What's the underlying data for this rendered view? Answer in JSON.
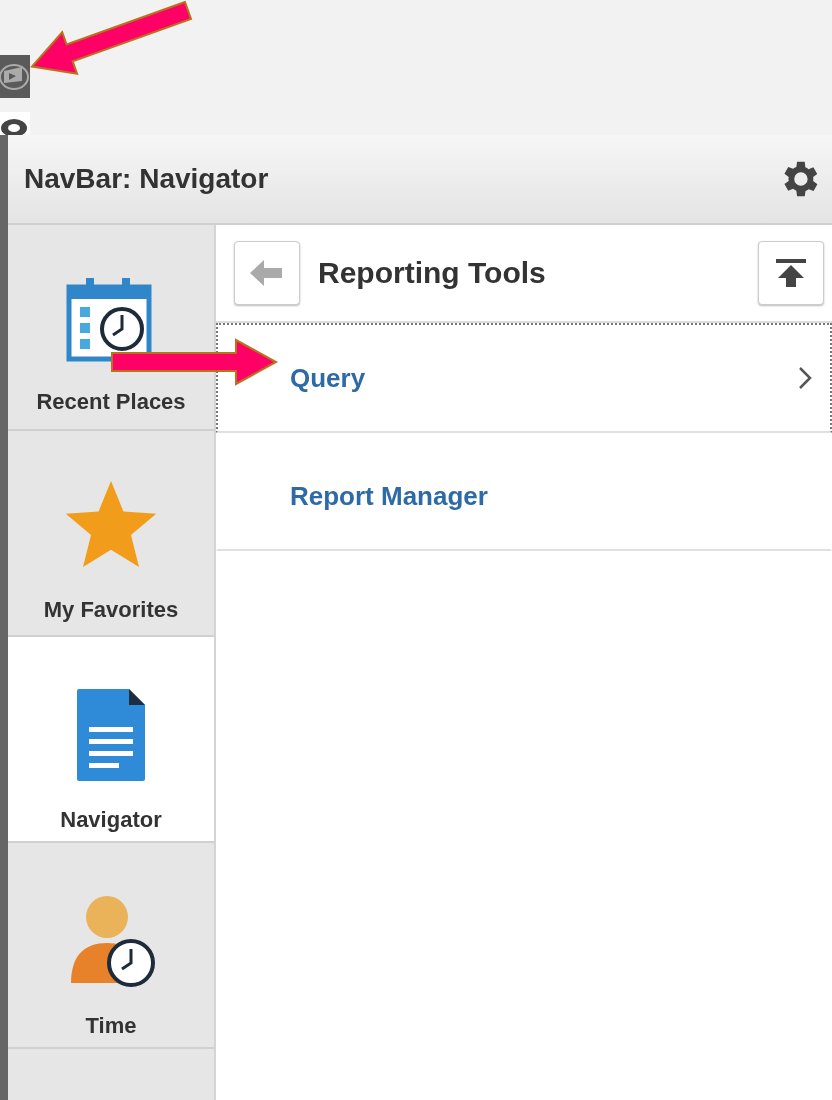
{
  "navbar": {
    "title": "NavBar: Navigator"
  },
  "tiles": [
    {
      "kind": "recent",
      "label": "Recent Places",
      "selected": false
    },
    {
      "kind": "favorites",
      "label": "My Favorites",
      "selected": false
    },
    {
      "kind": "navigator",
      "label": "Navigator",
      "selected": true
    },
    {
      "kind": "time",
      "label": "Time",
      "selected": false
    }
  ],
  "folder": {
    "title": "Reporting Tools"
  },
  "items": [
    {
      "label": "Query",
      "focused": true,
      "has_children": true
    },
    {
      "label": "Report Manager",
      "focused": false,
      "has_children": false
    }
  ]
}
